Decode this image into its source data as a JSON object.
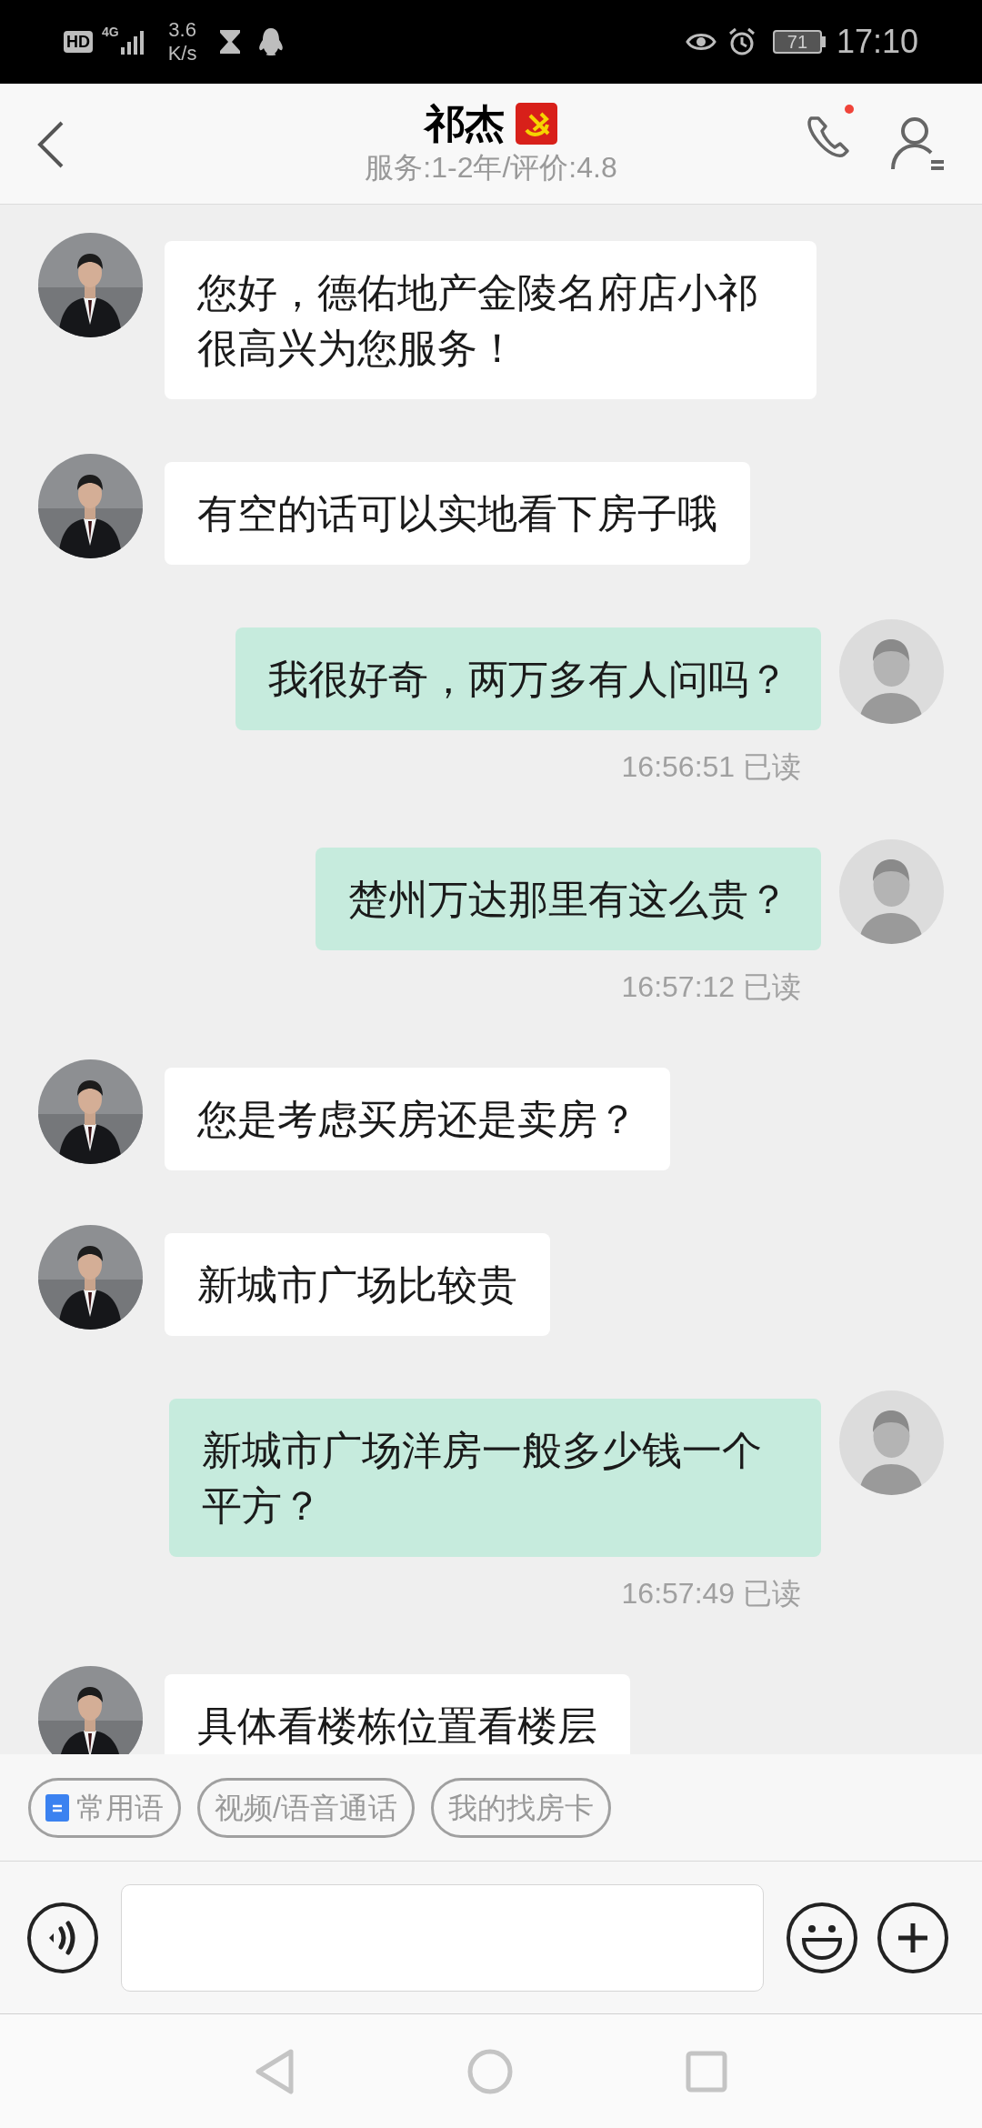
{
  "status_bar": {
    "hd": "HD",
    "network": "4G",
    "speed_value": "3.6",
    "speed_unit": "K/s",
    "battery": "71",
    "time": "17:10"
  },
  "header": {
    "title": "祁杰",
    "subtitle": "服务:1-2年/评价:4.8",
    "call_notification": true
  },
  "messages": [
    {
      "kind": "received",
      "text": "您好，德佑地产金陵名府店小祁很高兴为您服务！"
    },
    {
      "kind": "received",
      "text": "有空的话可以实地看下房子哦"
    },
    {
      "kind": "sent",
      "text": "我很好奇，两万多有人问吗？",
      "status": "16:56:51 已读"
    },
    {
      "kind": "sent",
      "text": "楚州万达那里有这么贵？",
      "status": "16:57:12 已读"
    },
    {
      "kind": "received",
      "text": "您是考虑买房还是卖房？"
    },
    {
      "kind": "received",
      "text": "新城市广场比较贵"
    },
    {
      "kind": "sent",
      "text": "新城市广场洋房一般多少钱一个平方？",
      "status": "16:57:49 已读"
    },
    {
      "kind": "received",
      "text": "具体看楼栋位置看楼层"
    }
  ],
  "quick_actions": [
    {
      "label": "常用语",
      "kind": "phrases"
    },
    {
      "label": "视频/语音通话",
      "kind": "plain"
    },
    {
      "label": "我的找房卡",
      "kind": "plain"
    }
  ]
}
